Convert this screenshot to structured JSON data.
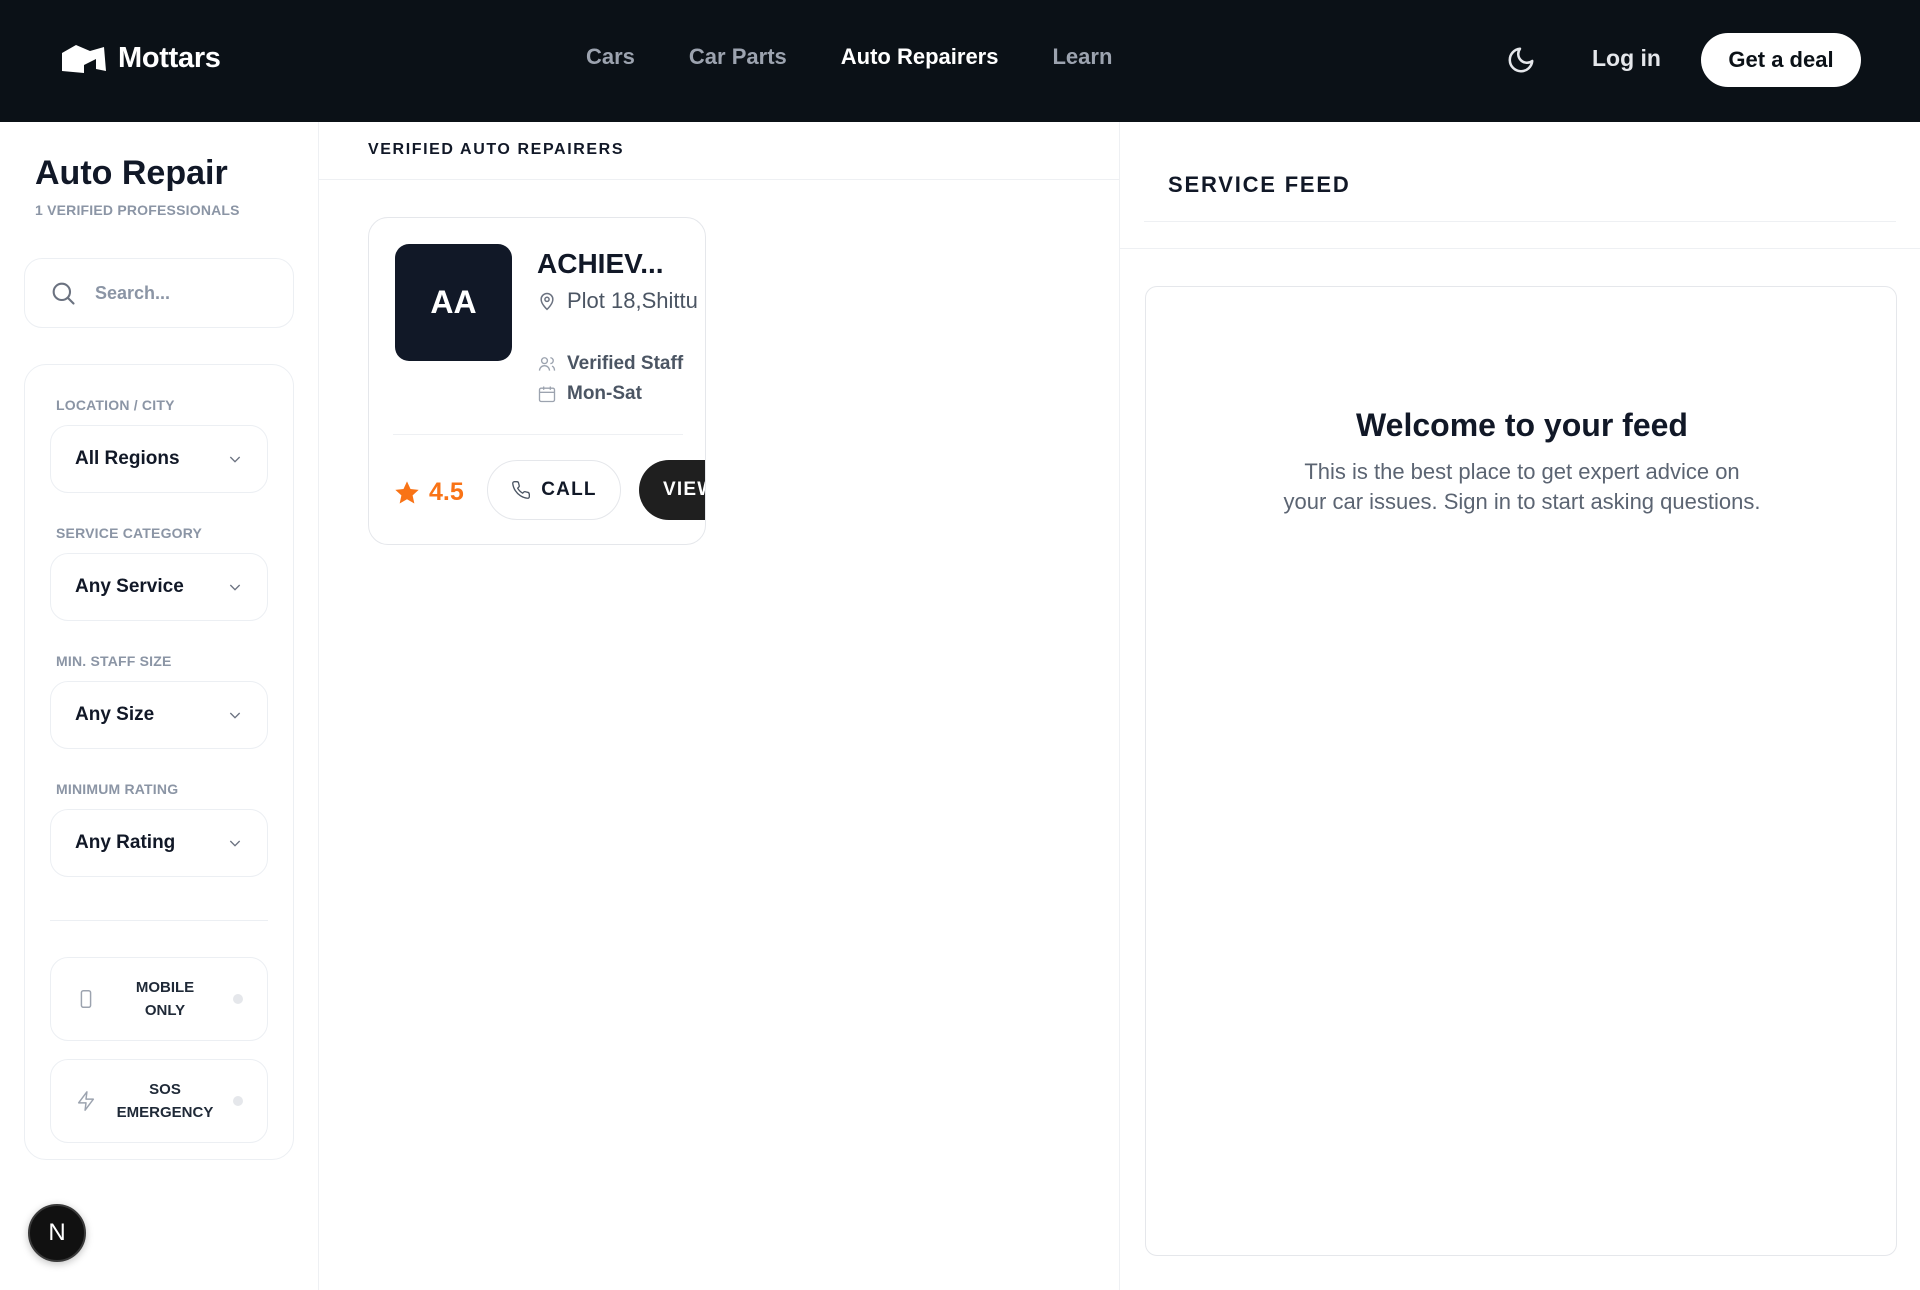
{
  "nav": {
    "brand": "Mottars",
    "links": [
      {
        "label": "Cars",
        "active": false
      },
      {
        "label": "Car Parts",
        "active": false
      },
      {
        "label": "Auto Repairers",
        "active": true
      },
      {
        "label": "Learn",
        "active": false
      }
    ],
    "login_label": "Log in",
    "cta_label": "Get a deal"
  },
  "sidebar": {
    "title": "Auto Repair",
    "subtitle": "1 VERIFIED PROFESSIONALS",
    "search_placeholder": "Search...",
    "filters": [
      {
        "label": "LOCATION / CITY",
        "value": "All Regions"
      },
      {
        "label": "SERVICE CATEGORY",
        "value": "Any Service"
      },
      {
        "label": "MIN. STAFF SIZE",
        "value": "Any Size"
      },
      {
        "label": "MINIMUM RATING",
        "value": "Any Rating"
      }
    ],
    "toggles": [
      {
        "label_line1": "MOBILE",
        "label_line2": "ONLY",
        "icon": "phone-device-icon",
        "enabled": false
      },
      {
        "label_line1": "SOS",
        "label_line2": "EMERGENCY",
        "icon": "lightning-icon",
        "enabled": false
      }
    ]
  },
  "main": {
    "section_title": "VERIFIED AUTO REPAIRERS",
    "repairers": [
      {
        "initials": "AA",
        "name": "ACHIEV...",
        "address": "Plot 18,Shittu",
        "staff": "Verified Staff",
        "hours": "Mon-Sat",
        "rating": "4.5",
        "call_label": "CALL",
        "view_label": "VIEW"
      }
    ]
  },
  "feed": {
    "title": "SERVICE FEED",
    "welcome": "Welcome to your feed",
    "description": "This is the best place to get expert advice on your car issues. Sign in to start asking questions."
  },
  "dev_badge": "N",
  "colors": {
    "nav_bg": "#0b1117",
    "accent_orange": "#f97316",
    "avatar_bg": "#111827",
    "muted_text": "#8b95a5"
  }
}
